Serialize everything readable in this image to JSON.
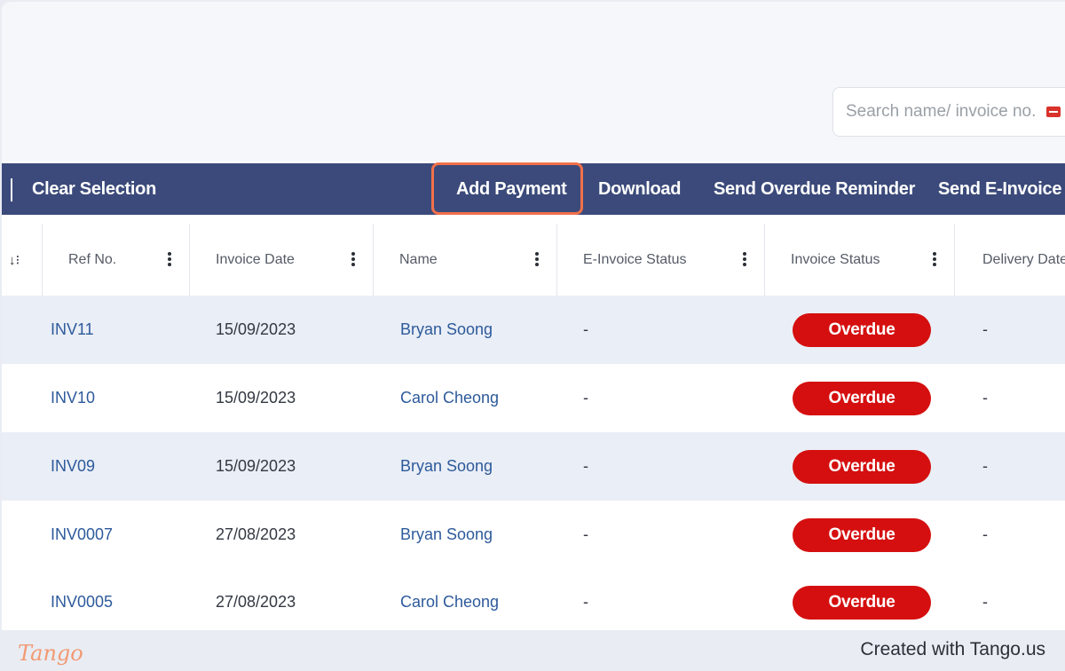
{
  "search": {
    "placeholder": "Search name/ invoice no."
  },
  "actions": {
    "clear_selection": "Clear Selection",
    "add_payment": "Add Payment",
    "download": "Download",
    "send_overdue_reminder": "Send Overdue Reminder",
    "send_einvoice": "Send E-Invoice"
  },
  "table": {
    "sort_icon": "↓⁝",
    "columns": [
      "Ref No.",
      "Invoice Date",
      "Name",
      "E-Invoice Status",
      "Invoice Status",
      "Delivery Date"
    ],
    "rows": [
      {
        "ref": "INV11",
        "date": "15/09/2023",
        "name": "Bryan Soong",
        "einvoice": "-",
        "status": "Overdue",
        "delivery": "-"
      },
      {
        "ref": "INV10",
        "date": "15/09/2023",
        "name": "Carol Cheong",
        "einvoice": "-",
        "status": "Overdue",
        "delivery": "-"
      },
      {
        "ref": "INV09",
        "date": "15/09/2023",
        "name": "Bryan Soong",
        "einvoice": "-",
        "status": "Overdue",
        "delivery": "-"
      },
      {
        "ref": "INV0007",
        "date": "27/08/2023",
        "name": "Bryan Soong",
        "einvoice": "-",
        "status": "Overdue",
        "delivery": "-"
      },
      {
        "ref": "INV0005",
        "date": "27/08/2023",
        "name": "Carol Cheong",
        "einvoice": "-",
        "status": "Overdue",
        "delivery": "-"
      }
    ]
  },
  "colors": {
    "action_bar": "#3b4a7a",
    "overdue_badge": "#d50f0f",
    "highlight_border": "#f2704a",
    "link_text": "#2d5a9b"
  },
  "footer": {
    "logo": "Tango",
    "credit": "Created with Tango.us"
  }
}
